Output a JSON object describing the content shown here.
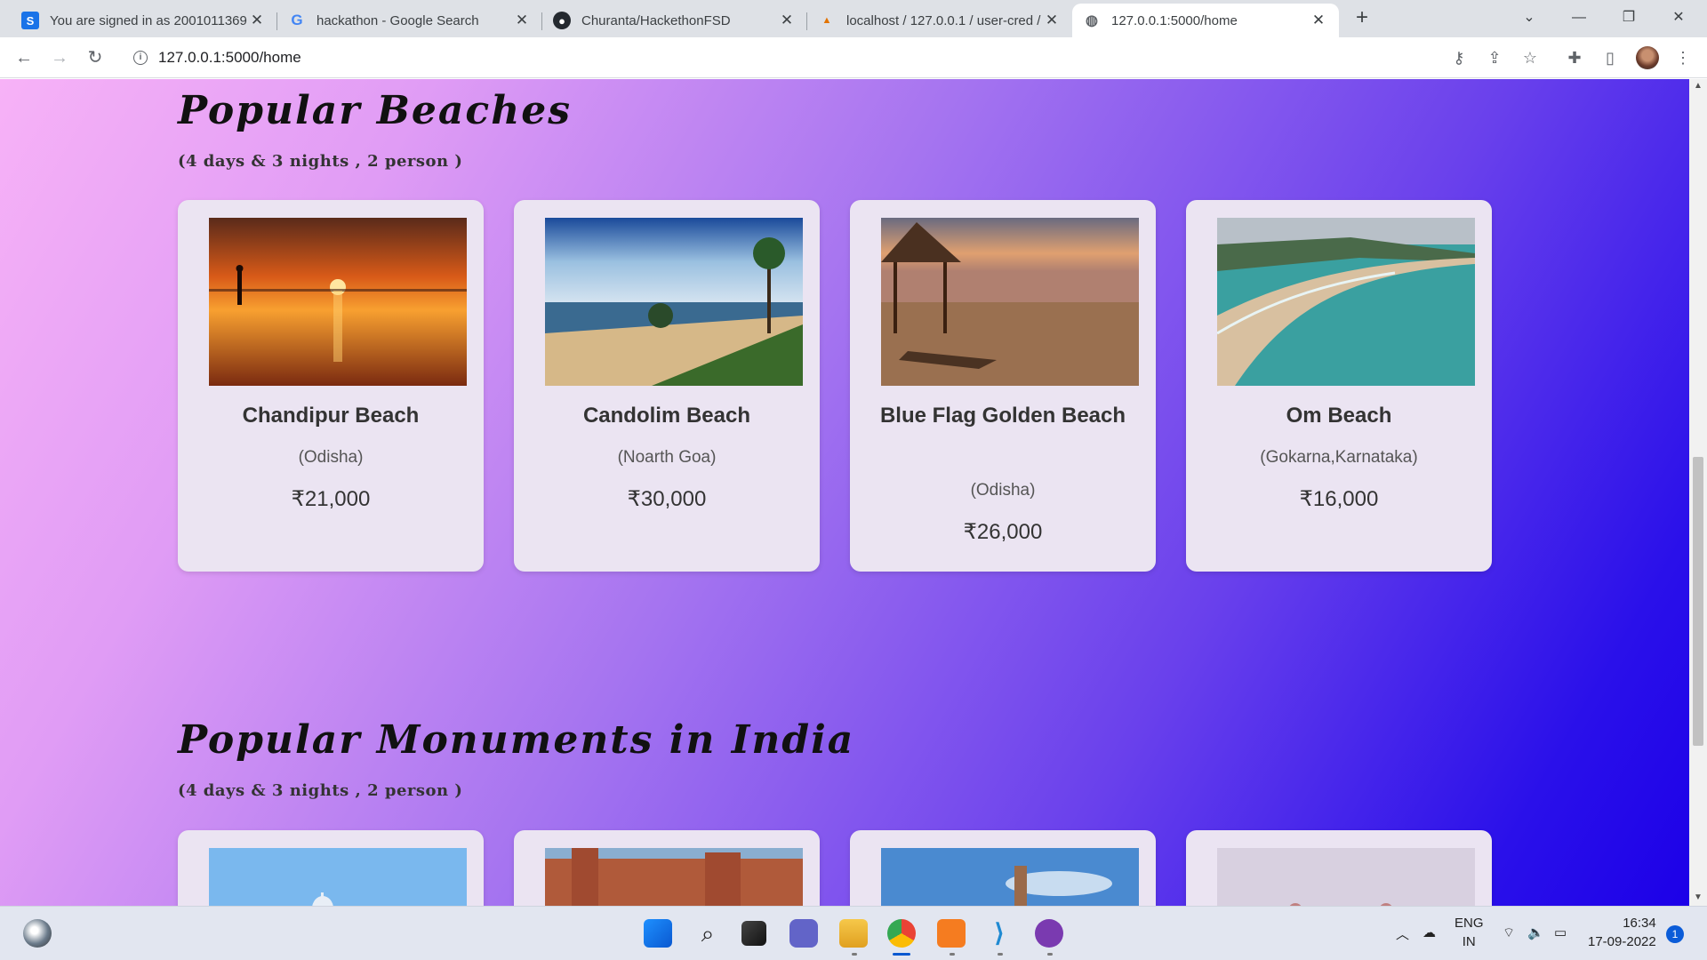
{
  "browser": {
    "tabs": [
      {
        "title": "You are signed in as 2001011369",
        "icon": "s-letter-icon",
        "active": false
      },
      {
        "title": "hackathon - Google Search",
        "icon": "google-icon",
        "active": false
      },
      {
        "title": "Churanta/HackethonFSD",
        "icon": "github-icon",
        "active": false
      },
      {
        "title": "localhost / 127.0.0.1 / user-cred / ",
        "icon": "phpmyadmin-icon",
        "active": false
      },
      {
        "title": "127.0.0.1:5000/home",
        "icon": "globe-icon",
        "active": true
      }
    ],
    "url": "127.0.0.1:5000/home"
  },
  "sections": [
    {
      "title": "Popular Beaches",
      "subtitle": "(4 days & 3 nights , 2 person )",
      "cards": [
        {
          "name": "Chandipur Beach",
          "location": "(Odisha)",
          "price": "₹21,000"
        },
        {
          "name": "Candolim Beach",
          "location": "(Noarth Goa)",
          "price": "₹30,000"
        },
        {
          "name": "Blue Flag Golden Beach",
          "location": "(Odisha)",
          "price": "₹26,000"
        },
        {
          "name": "Om Beach",
          "location": "(Gokarna,Karnataka)",
          "price": "₹16,000"
        }
      ]
    },
    {
      "title": "Popular Monuments in India",
      "subtitle": "(4 days & 3 nights , 2 person )"
    }
  ],
  "taskbar": {
    "language": "ENG",
    "region": "IN",
    "time": "16:34",
    "date": "17-09-2022",
    "notification_count": "1"
  },
  "colors": {
    "gradient_start": "#f7b2f7",
    "gradient_end": "#1c00e8",
    "card_bg": "#ebe4f2"
  }
}
